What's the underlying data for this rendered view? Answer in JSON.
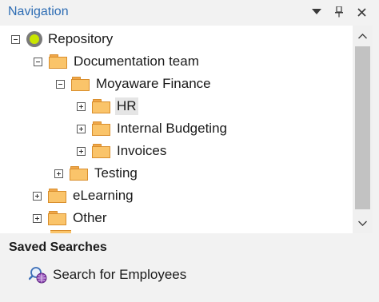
{
  "panel": {
    "title": "Navigation",
    "buttons": {
      "dropdown_icon": "chevron-down-icon",
      "pin_icon": "pin-icon",
      "close_icon": "close-icon"
    }
  },
  "tree": {
    "repository": {
      "label": "Repository",
      "expanded": true
    },
    "documentation_team": {
      "label": "Documentation team",
      "expanded": true
    },
    "moyaware_finance": {
      "label": "Moyaware Finance",
      "expanded": true
    },
    "hr": {
      "label": "HR",
      "expanded": false,
      "selected": true
    },
    "internal_budgeting": {
      "label": "Internal Budgeting",
      "expanded": false
    },
    "invoices": {
      "label": "Invoices",
      "expanded": false
    },
    "testing": {
      "label": "Testing",
      "expanded": false
    },
    "elearning": {
      "label": "eLearning",
      "expanded": false
    },
    "other": {
      "label": "Other",
      "expanded": false
    }
  },
  "saved_searches": {
    "title": "Saved Searches",
    "items": [
      {
        "label": "Search for Employees",
        "icon": "search-globe-icon"
      }
    ]
  },
  "colors": {
    "title": "#2e6db4",
    "folder": "#fac46a",
    "repository": "#c9e600"
  }
}
